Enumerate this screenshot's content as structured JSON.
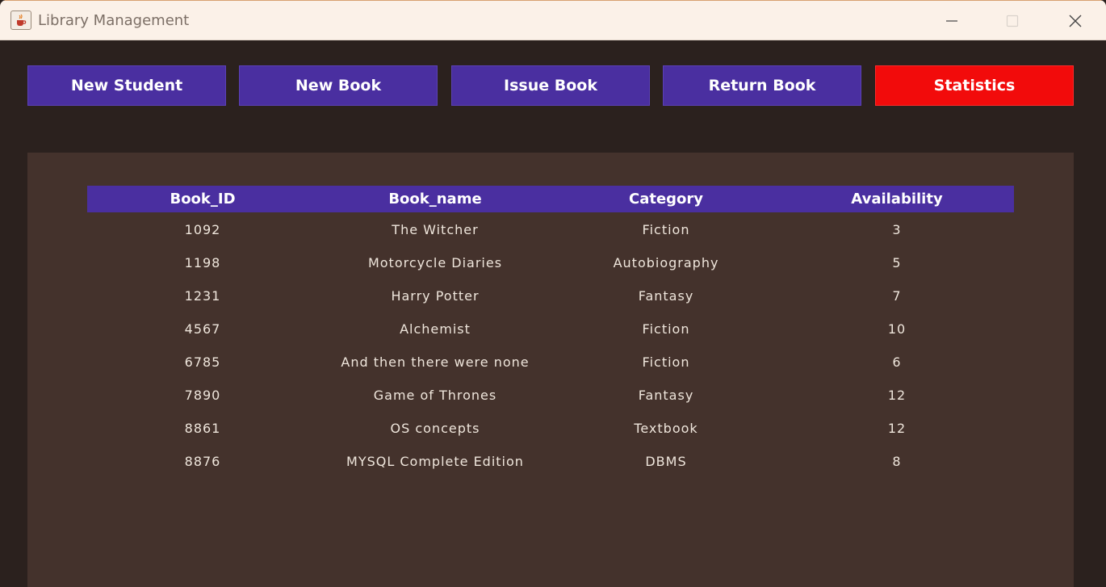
{
  "window": {
    "title": "Library Management"
  },
  "nav": {
    "buttons": [
      {
        "label": "New Student"
      },
      {
        "label": "New Book"
      },
      {
        "label": "Issue Book"
      },
      {
        "label": "Return Book"
      },
      {
        "label": "Statistics"
      }
    ]
  },
  "table": {
    "columns": [
      "Book_ID",
      "Book_name",
      "Category",
      "Availability"
    ],
    "rows": [
      [
        "1092",
        "The Witcher",
        "Fiction",
        "3"
      ],
      [
        "1198",
        "Motorcycle Diaries",
        "Autobiography",
        "5"
      ],
      [
        "1231",
        "Harry Potter",
        "Fantasy",
        "7"
      ],
      [
        "4567",
        "Alchemist",
        "Fiction",
        "10"
      ],
      [
        "6785",
        "And then there were none",
        "Fiction",
        "6"
      ],
      [
        "7890",
        "Game of Thrones",
        "Fantasy",
        "12"
      ],
      [
        "8861",
        "OS concepts",
        "Textbook",
        "12"
      ],
      [
        "8876",
        "MYSQL Complete Edition",
        "DBMS",
        "8"
      ]
    ]
  },
  "colors": {
    "button": "#4a2fa0",
    "active_button": "#f20b0b",
    "panel": "#44322c",
    "background": "#2b211e"
  },
  "icons": {
    "app": "java-cup-icon",
    "minimize": "minimize-icon",
    "maximize": "maximize-icon",
    "close": "close-icon"
  }
}
